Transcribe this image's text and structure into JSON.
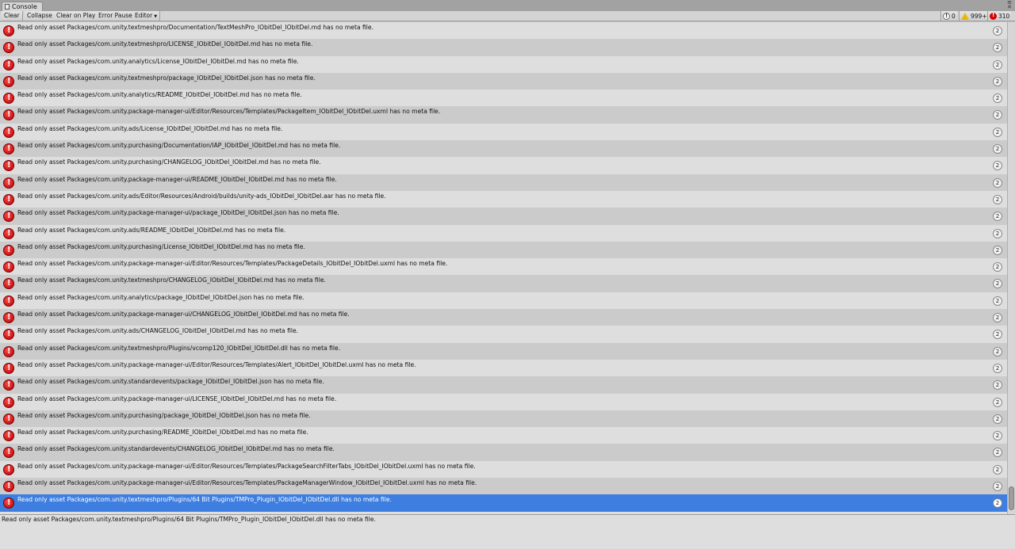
{
  "window": {
    "tab_title": "Console"
  },
  "toolbar": {
    "clear": "Clear",
    "collapse": "Collapse",
    "clear_on_play": "Clear on Play",
    "error_pause": "Error Pause",
    "editor": "Editor"
  },
  "counters": {
    "info": "0",
    "warnings": "999+",
    "errors": "310"
  },
  "logs": [
    {
      "message": "Read only asset Packages/com.unity.textmeshpro/Documentation/TextMeshPro_IObitDel_IObitDel.md has no meta file.",
      "count": "2"
    },
    {
      "message": "Read only asset Packages/com.unity.textmeshpro/LICENSE_IObitDel_IObitDel.md has no meta file.",
      "count": "2"
    },
    {
      "message": "Read only asset Packages/com.unity.analytics/License_IObitDel_IObitDel.md has no meta file.",
      "count": "2"
    },
    {
      "message": "Read only asset Packages/com.unity.textmeshpro/package_IObitDel_IObitDel.json has no meta file.",
      "count": "2"
    },
    {
      "message": "Read only asset Packages/com.unity.analytics/README_IObitDel_IObitDel.md has no meta file.",
      "count": "2"
    },
    {
      "message": "Read only asset Packages/com.unity.package-manager-ui/Editor/Resources/Templates/PackageItem_IObitDel_IObitDel.uxml has no meta file.",
      "count": "2"
    },
    {
      "message": "Read only asset Packages/com.unity.ads/License_IObitDel_IObitDel.md has no meta file.",
      "count": "2"
    },
    {
      "message": "Read only asset Packages/com.unity.purchasing/Documentation/IAP_IObitDel_IObitDel.md has no meta file.",
      "count": "2"
    },
    {
      "message": "Read only asset Packages/com.unity.purchasing/CHANGELOG_IObitDel_IObitDel.md has no meta file.",
      "count": "2"
    },
    {
      "message": "Read only asset Packages/com.unity.package-manager-ui/README_IObitDel_IObitDel.md has no meta file.",
      "count": "2"
    },
    {
      "message": "Read only asset Packages/com.unity.ads/Editor/Resources/Android/builds/unity-ads_IObitDel_IObitDel.aar has no meta file.",
      "count": "2"
    },
    {
      "message": "Read only asset Packages/com.unity.package-manager-ui/package_IObitDel_IObitDel.json has no meta file.",
      "count": "2"
    },
    {
      "message": "Read only asset Packages/com.unity.ads/README_IObitDel_IObitDel.md has no meta file.",
      "count": "2"
    },
    {
      "message": "Read only asset Packages/com.unity.purchasing/License_IObitDel_IObitDel.md has no meta file.",
      "count": "2"
    },
    {
      "message": "Read only asset Packages/com.unity.package-manager-ui/Editor/Resources/Templates/PackageDetails_IObitDel_IObitDel.uxml has no meta file.",
      "count": "2"
    },
    {
      "message": "Read only asset Packages/com.unity.textmeshpro/CHANGELOG_IObitDel_IObitDel.md has no meta file.",
      "count": "2"
    },
    {
      "message": "Read only asset Packages/com.unity.analytics/package_IObitDel_IObitDel.json has no meta file.",
      "count": "2"
    },
    {
      "message": "Read only asset Packages/com.unity.package-manager-ui/CHANGELOG_IObitDel_IObitDel.md has no meta file.",
      "count": "2"
    },
    {
      "message": "Read only asset Packages/com.unity.ads/CHANGELOG_IObitDel_IObitDel.md has no meta file.",
      "count": "2"
    },
    {
      "message": "Read only asset Packages/com.unity.textmeshpro/Plugins/vcomp120_IObitDel_IObitDel.dll has no meta file.",
      "count": "2"
    },
    {
      "message": "Read only asset Packages/com.unity.package-manager-ui/Editor/Resources/Templates/Alert_IObitDel_IObitDel.uxml has no meta file.",
      "count": "2"
    },
    {
      "message": "Read only asset Packages/com.unity.standardevents/package_IObitDel_IObitDel.json has no meta file.",
      "count": "2"
    },
    {
      "message": "Read only asset Packages/com.unity.package-manager-ui/LICENSE_IObitDel_IObitDel.md has no meta file.",
      "count": "2"
    },
    {
      "message": "Read only asset Packages/com.unity.purchasing/package_IObitDel_IObitDel.json has no meta file.",
      "count": "2"
    },
    {
      "message": "Read only asset Packages/com.unity.purchasing/README_IObitDel_IObitDel.md has no meta file.",
      "count": "2"
    },
    {
      "message": "Read only asset Packages/com.unity.standardevents/CHANGELOG_IObitDel_IObitDel.md has no meta file.",
      "count": "2"
    },
    {
      "message": "Read only asset Packages/com.unity.package-manager-ui/Editor/Resources/Templates/PackageSearchFilterTabs_IObitDel_IObitDel.uxml has no meta file.",
      "count": "2"
    },
    {
      "message": "Read only asset Packages/com.unity.package-manager-ui/Editor/Resources/Templates/PackageManagerWindow_IObitDel_IObitDel.uxml has no meta file.",
      "count": "2"
    },
    {
      "message": "Read only asset Packages/com.unity.textmeshpro/Plugins/64 Bit Plugins/TMPro_Plugin_IObitDel_IObitDel.dll has no meta file.",
      "count": "2",
      "selected": true
    }
  ],
  "detail": {
    "text": "Read only asset Packages/com.unity.textmeshpro/Plugins/64 Bit Plugins/TMPro_Plugin_IObitDel_IObitDel.dll has no meta file."
  },
  "icons": {
    "tab": "console-icon",
    "row": "error-icon",
    "info_counter": "info-icon",
    "warn_counter": "warning-icon",
    "error_counter": "error-icon"
  },
  "colors": {
    "selected_row": "#3d7ee0",
    "error_red": "#d80000",
    "warning_yellow": "#e8b800"
  }
}
